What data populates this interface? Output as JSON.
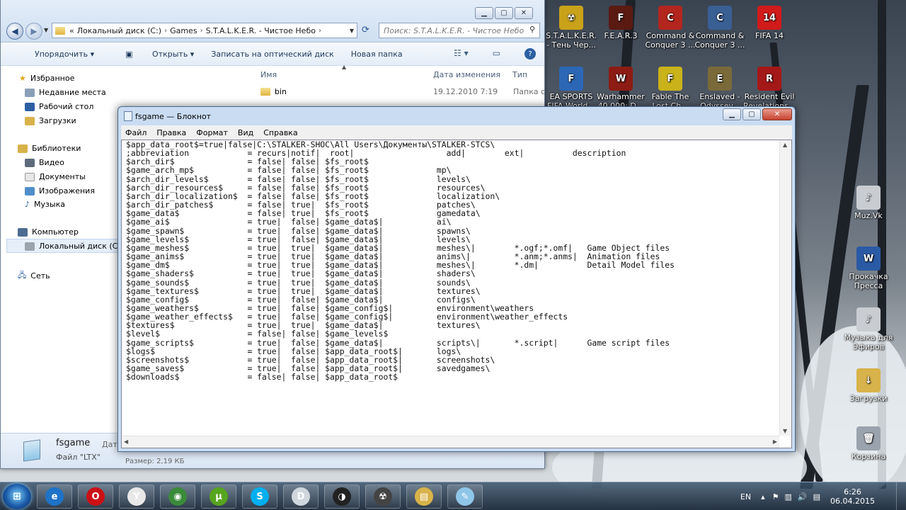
{
  "explorer": {
    "address": {
      "prefix": "«",
      "parts": [
        "Локальный диск (C:)",
        "Games",
        "S.T.A.L.K.E.R. - Чистое Небо"
      ]
    },
    "search_placeholder": "Поиск: S.T.A.L.K.E.R. - Чистое Небо",
    "toolbar": {
      "organize": "Упорядочить",
      "open": "Открыть",
      "burn": "Записать на оптический диск",
      "new_folder": "Новая папка"
    },
    "nav": {
      "favorites": "Избранное",
      "recent": "Недавние места",
      "desktop": "Рабочий стол",
      "downloads": "Загрузки",
      "libraries": "Библиотеки",
      "video": "Видео",
      "documents": "Документы",
      "images": "Изображения",
      "music": "Музыка",
      "computer": "Компьютер",
      "local_disk": "Локальный диск (C:)",
      "network": "Сеть"
    },
    "columns": {
      "name": "Имя",
      "date": "Дата изменения",
      "type": "Тип"
    },
    "rows": [
      {
        "name": "bin",
        "date": "19.12.2010 7:19",
        "type": "Папка с"
      }
    ],
    "details": {
      "name": "fsgame",
      "kind": "Файл \"LTX\"",
      "date_label": "Дата",
      "size": "Размер: 2,19 КБ"
    }
  },
  "notepad": {
    "title": "fsgame — Блокнот",
    "menu": [
      "Файл",
      "Правка",
      "Формат",
      "Вид",
      "Справка"
    ],
    "lines": [
      "$app_data_root$=true|false|C:\\STALKER-SHOC\\All Users\\Документы\\STALKER-STCS\\",
      ";abbreviation            = recurs|notif|  root|                   add|        ext|          description",
      "$arch_dir$               = false| false| $fs_root$",
      "$game_arch_mp$           = false| false| $fs_root$              mp\\",
      "$arch_dir_levels$        = false| false| $fs_root$              levels\\",
      "$arch_dir_resources$     = false| false| $fs_root$              resources\\",
      "$arch_dir_localization$  = false| false| $fs_root$              localization\\",
      "$arch_dir_patches$       = false| true|  $fs_root$              patches\\",
      "$game_data$              = false| true|  $fs_root$              gamedata\\",
      "$game_ai$                = true|  false| $game_data$|           ai\\",
      "$game_spawn$             = true|  false| $game_data$|           spawns\\",
      "$game_levels$            = true|  false| $game_data$|           levels\\",
      "$game_meshes$            = true|  true|  $game_data$|           meshes\\|        *.ogf;*.omf|   Game Object files",
      "$game_anims$             = true|  true|  $game_data$|           anims\\|         *.anm;*.anms|  Animation files",
      "$game_dm$                = true|  true|  $game_data$|           meshes\\|        *.dm|          Detail Model files",
      "$game_shaders$           = true|  true|  $game_data$|           shaders\\",
      "$game_sounds$            = true|  true|  $game_data$|           sounds\\",
      "$game_textures$          = true|  true|  $game_data$|           textures\\",
      "$game_config$            = true|  false| $game_data$|           configs\\",
      "$game_weathers$          = true|  false| $game_config$|         environment\\weathers",
      "$game_weather_effects$   = true|  false| $game_config$|         environment\\weather_effects",
      "$textures$               = true|  true|  $game_data$|           textures\\",
      "$level$                  = false| false| $game_levels$",
      "$game_scripts$           = true|  false| $game_data$|           scripts\\|       *.script|      Game script files",
      "$logs$                   = true|  false| $app_data_root$|       logs\\",
      "$screenshots$            = true|  false| $app_data_root$|       screenshots\\",
      "$game_saves$             = true|  false| $app_data_root$|       savedgames\\",
      "$downloads$              = false| false| $app_data_root$"
    ]
  },
  "desktop_icons": [
    {
      "label": "S.T.A.L.K.E.R. - Тень Чер...",
      "color": "#c9a21a",
      "glyph": "☢"
    },
    {
      "label": "F.E.A.R.3",
      "color": "#5a1a12",
      "glyph": "F"
    },
    {
      "label": "Command & Conquer 3 ...",
      "color": "#b3261e",
      "glyph": "C"
    },
    {
      "label": "Command & Conquer 3 ...",
      "color": "#3a5f93",
      "glyph": "C"
    },
    {
      "label": "FIFA 14",
      "color": "#d11a1a",
      "glyph": "14"
    },
    {
      "label": "EA SPORTS FIFA World...",
      "color": "#2c67b5",
      "glyph": "F"
    },
    {
      "label": "Warhammer 40,000: D...",
      "color": "#8c1c14",
      "glyph": "W"
    },
    {
      "label": "Fable The Lost Ch...",
      "color": "#c9b21a",
      "glyph": "F"
    },
    {
      "label": "Enslaved - Odyssey...",
      "color": "#7a6a3a",
      "glyph": "E"
    },
    {
      "label": "Resident Evil Revelations...",
      "color": "#a51818",
      "glyph": "R"
    },
    {
      "label": "Muz.Vk",
      "color": "#c9cdd2",
      "glyph": "♪"
    },
    {
      "label": "Прокачка Пресса",
      "color": "#2b5aa5",
      "glyph": "W"
    },
    {
      "label": "Музыка для Эфиров",
      "color": "#c9cdd2",
      "glyph": "♪"
    },
    {
      "label": "Загрузки",
      "color": "#d8b24a",
      "glyph": "↓"
    },
    {
      "label": "Корзина",
      "color": "#9aa3ad",
      "glyph": "🗑"
    }
  ],
  "taskbar": {
    "start_label": "⊞",
    "apps": [
      {
        "name": "ie",
        "color": "#1e73c8",
        "glyph": "e"
      },
      {
        "name": "opera",
        "color": "#cc1016",
        "glyph": "O"
      },
      {
        "name": "yandex",
        "color": "#e8e8e8",
        "glyph": "Y"
      },
      {
        "name": "chrome",
        "color": "#3a8b3a",
        "glyph": "◉"
      },
      {
        "name": "utorrent",
        "color": "#57a51e",
        "glyph": "µ"
      },
      {
        "name": "skype",
        "color": "#00aff0",
        "glyph": "S"
      },
      {
        "name": "dell",
        "color": "#cfd6dd",
        "glyph": "D"
      },
      {
        "name": "obs",
        "color": "#222",
        "glyph": "◑"
      },
      {
        "name": "stalker",
        "color": "#444",
        "glyph": "☢"
      },
      {
        "name": "explorer",
        "color": "#d8b24a",
        "glyph": "▤"
      },
      {
        "name": "notepad",
        "color": "#8fc6e8",
        "glyph": "✎"
      }
    ],
    "lang": "EN",
    "time": "6:26",
    "date": "06.04.2015"
  }
}
